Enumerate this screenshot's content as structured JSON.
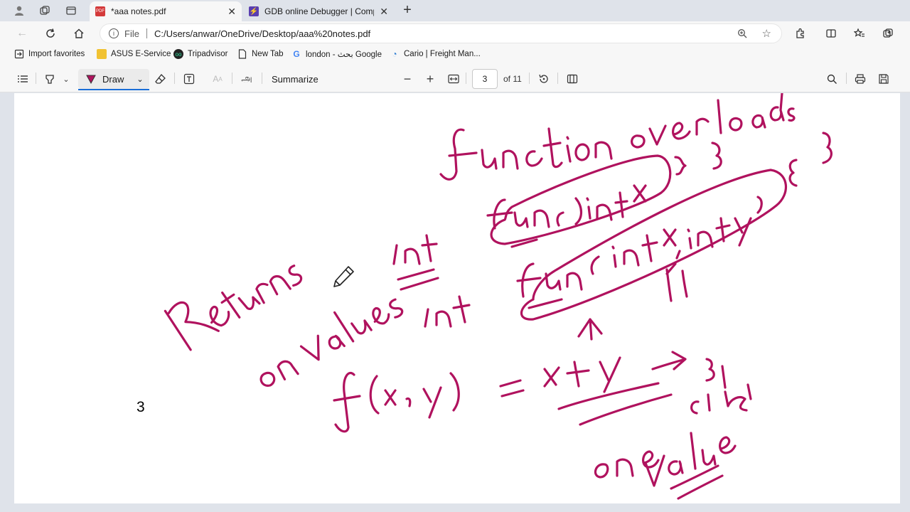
{
  "browser": {
    "tabs": [
      {
        "title": "*aaa notes.pdf",
        "favicon": "pdf-icon",
        "active": true
      },
      {
        "title": "GDB online Debugger | Compiler",
        "favicon": "gdb-bolt-icon",
        "active": false
      }
    ],
    "address": {
      "file_label": "File",
      "url": "C:/Users/anwar/OneDrive/Desktop/aaa%20notes.pdf"
    },
    "favorites": [
      {
        "label": "Import favorites",
        "icon": "import-icon"
      },
      {
        "label": "ASUS E-Service",
        "icon": "folder-icon"
      },
      {
        "label": "Tripadvisor",
        "icon": "tripadvisor-icon"
      },
      {
        "label": "New Tab",
        "icon": "page-icon"
      },
      {
        "label": "london - بحث Google",
        "icon": "google-icon"
      },
      {
        "label": "Cario | Freight Man...",
        "icon": "cario-icon"
      }
    ]
  },
  "pdf_toolbar": {
    "draw_label": "Draw",
    "summarize_label": "Summarize",
    "page_current": "3",
    "page_total": "of 11",
    "read_aloud_glyph": "அ"
  },
  "document": {
    "page_number": "3"
  },
  "colors": {
    "ink": "#b0125e",
    "accent": "#1a6ed8"
  }
}
